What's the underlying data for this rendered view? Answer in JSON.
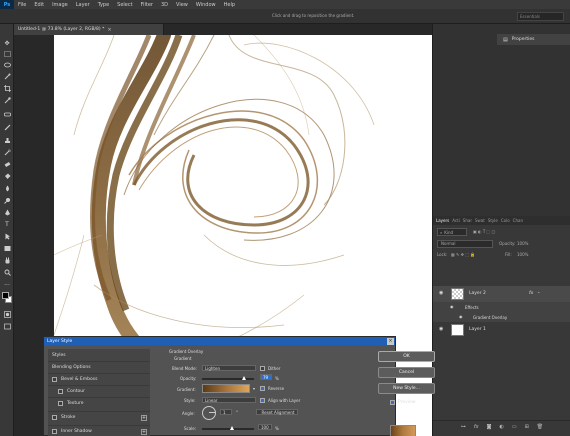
{
  "app": {
    "logo": "Ps"
  },
  "menu": [
    "File",
    "Edit",
    "Image",
    "Layer",
    "Type",
    "Select",
    "Filter",
    "3D",
    "View",
    "Window",
    "Help"
  ],
  "options_bar": {
    "hint": "Click and drag to reposition the gradient.",
    "workspace": "Essentials"
  },
  "document": {
    "tab_title": "Untitled-1 @ 73.8% (Layer 2, RGB/8) *",
    "close": "×"
  },
  "properties": {
    "label": "Properties"
  },
  "layers_panel": {
    "tabs": [
      "Layers",
      "Acti",
      "Shar",
      "Swat",
      "Style",
      "Colo",
      "Chan"
    ],
    "kind_label": "Kind",
    "blend_mode": "Normal",
    "opacity_label": "Opacity:",
    "opacity_value": "100%",
    "lock_label": "Lock:",
    "fill_label": "Fill:",
    "fill_value": "100%",
    "layers": [
      {
        "name": "Layer 2",
        "fx": "fx"
      },
      {
        "name": "Effects"
      },
      {
        "name": "Gradient Overlay"
      },
      {
        "name": "Layer 1"
      }
    ]
  },
  "dialog": {
    "title": "Layer Style",
    "styles_list": [
      {
        "label": "Styles",
        "checkbox": false,
        "plus": false
      },
      {
        "label": "Blending Options",
        "checkbox": false,
        "plus": false
      },
      {
        "label": "Bevel & Emboss",
        "checkbox": true,
        "plus": false
      },
      {
        "label": "Contour",
        "checkbox": true,
        "plus": false
      },
      {
        "label": "Texture",
        "checkbox": true,
        "plus": false
      },
      {
        "label": "Stroke",
        "checkbox": true,
        "plus": true
      },
      {
        "label": "Inner Shadow",
        "checkbox": true,
        "plus": true
      }
    ],
    "section_title": "Gradient Overlay",
    "section_subtitle": "Gradient",
    "blend_mode_label": "Blend Mode:",
    "blend_mode_value": "Lighten",
    "dither_label": "Dither",
    "opacity_label": "Opacity:",
    "opacity_value": "79",
    "percent": "%",
    "gradient_label": "Gradient:",
    "reverse_label": "Reverse",
    "style_label": "Style:",
    "style_value": "Linear",
    "align_label": "Align with Layer",
    "angle_label": "Angle:",
    "angle_value": "1",
    "degree": "°",
    "reset_label": "Reset Alignment",
    "scale_label": "Scale:",
    "scale_value": "100",
    "ok": "OK",
    "cancel": "Cancel",
    "new_style": "New Style...",
    "preview": "Preview"
  },
  "colors": {
    "accent": "#1f5fb5",
    "hair_dark": "#6b4a1d",
    "hair_light": "#b89a6a",
    "gradient_start": "#5a3a14",
    "gradient_end": "#e0a556"
  },
  "icons": [
    "move-icon",
    "marquee-icon",
    "lasso-icon",
    "quick-select-icon",
    "crop-icon",
    "eyedropper-icon",
    "healing-icon",
    "brush-icon",
    "stamp-icon",
    "history-brush-icon",
    "eraser-icon",
    "bucket-icon",
    "blur-icon",
    "dodge-icon",
    "pen-icon",
    "type-icon",
    "path-select-icon",
    "rectangle-icon",
    "hand-icon",
    "zoom-icon",
    "eye-icon"
  ]
}
